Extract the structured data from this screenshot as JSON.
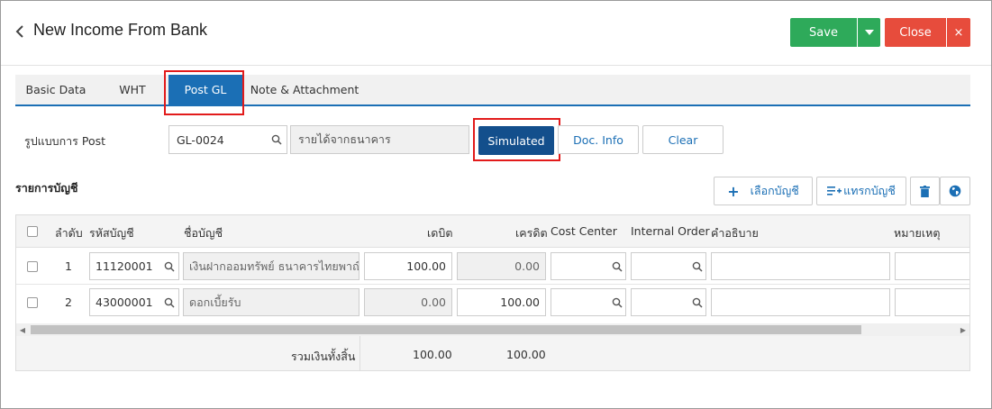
{
  "header": {
    "title": "New Income From Bank",
    "save_label": "Save",
    "close_label": "Close",
    "close_x": "×"
  },
  "tabs": [
    {
      "label": "Basic Data"
    },
    {
      "label": "WHT"
    },
    {
      "label": "Post GL"
    },
    {
      "label": "Note & Attachment"
    }
  ],
  "form": {
    "post_format_label": "รูปแบบการ Post",
    "post_code": "GL-0024",
    "post_name": "รายได้จากธนาคาร",
    "simulated_label": "Simulated",
    "docinfo_label": "Doc. Info",
    "clear_label": "Clear"
  },
  "accounts": {
    "section_title": "รายการบัญชี",
    "select_label": "เลือกบัญชี",
    "insert_label": "แทรกบัญชี"
  },
  "table": {
    "headers": {
      "no": "ลำดับ",
      "code": "รหัสบัญชี",
      "name": "ชื่อบัญชี",
      "debit": "เดบิต",
      "credit": "เครดิต",
      "cost_center": "Cost Center",
      "internal_order": "Internal Order",
      "desc": "คำอธิบาย",
      "remark": "หมายเหตุ"
    },
    "rows": [
      {
        "no": "1",
        "code": "11120001",
        "name": "เงินฝากออมทรัพย์ ธนาคารไทยพาณิชย์",
        "debit": "100.00",
        "credit": "0.00"
      },
      {
        "no": "2",
        "code": "43000001",
        "name": "ดอกเบี้ยรับ",
        "debit": "0.00",
        "credit": "100.00"
      }
    ],
    "footer": {
      "label": "รวมเงินทั้งสิ้น",
      "debit_total": "100.00",
      "credit_total": "100.00"
    }
  },
  "colors": {
    "accent": "#1b6fb5",
    "save": "#2eaa5a",
    "close": "#e74c3c",
    "highlight": "#e21b1b"
  }
}
